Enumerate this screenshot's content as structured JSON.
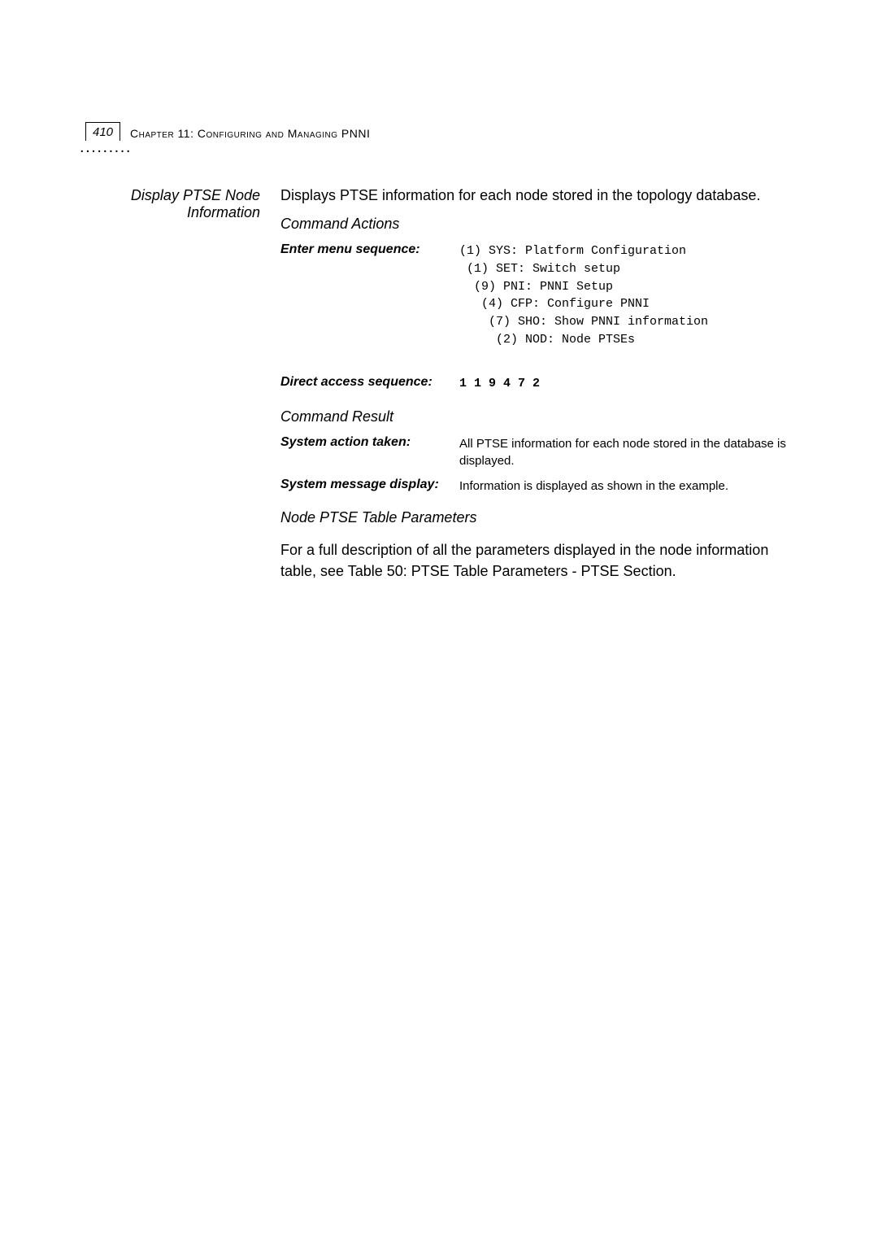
{
  "pageNumber": "410",
  "chapterLabel": "Chapter 11: Configuring and Managing PNNI",
  "section": {
    "title": "Display PTSE Node Information",
    "intro": "Displays PTSE information for each node stored in the topology database.",
    "commandActionsHeading": "Command Actions",
    "enterMenuLabel": "Enter menu sequence:",
    "menuSequence": "(1) SYS: Platform Configuration\n (1) SET: Switch setup\n  (9) PNI: PNNI Setup\n   (4) CFP: Configure PNNI\n    (7) SHO: Show PNNI information\n     (2) NOD: Node PTSEs",
    "directAccessLabel": "Direct access sequence:",
    "directAccessValue": "1 1 9 4 7 2",
    "commandResultHeading": "Command Result",
    "systemActionLabel": "System action taken:",
    "systemActionValue": "All PTSE information for each node stored in the database is displayed.",
    "systemMessageLabel": "System message display:",
    "systemMessageValue": "Information is displayed as shown in the example.",
    "nodePtseHeading": "Node PTSE Table Parameters",
    "bodyText": "For a full description of all the parameters displayed in the node information table, see Table 50: PTSE Table Parameters - PTSE Section."
  }
}
